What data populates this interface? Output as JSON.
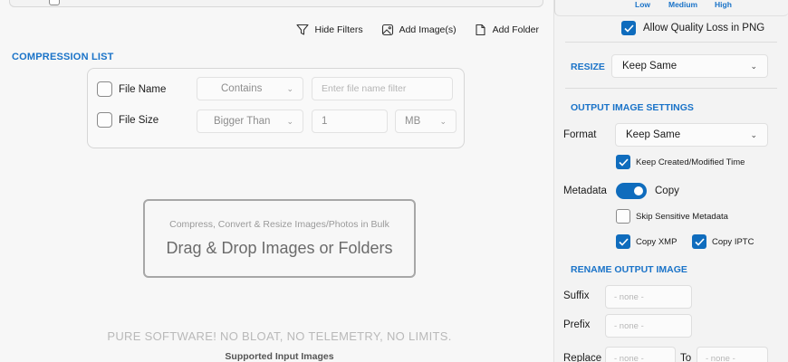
{
  "toolbar": {
    "hide_filters": "Hide Filters",
    "add_images": "Add Image(s)",
    "add_folder": "Add Folder"
  },
  "compression_list": {
    "title": "COMPRESSION LIST",
    "filters": {
      "file_name": {
        "label": "File Name",
        "operator": "Contains",
        "placeholder": "Enter file name filter"
      },
      "file_size": {
        "label": "File Size",
        "operator": "Bigger Than",
        "value": "1",
        "unit": "MB"
      }
    }
  },
  "drop_zone": {
    "subtitle": "Compress, Convert & Resize Images/Photos in Bulk",
    "title": "Drag & Drop Images or Folders"
  },
  "footer": {
    "tagline": "PURE SOFTWARE! NO BLOAT, NO TELEMETRY, NO LIMITS.",
    "supported": "Supported Input Images"
  },
  "settings": {
    "quality_levels": [
      "Low",
      "Medium",
      "High"
    ],
    "allow_quality_loss_png": {
      "label": "Allow Quality Loss in PNG",
      "checked": true
    },
    "resize": {
      "title": "RESIZE",
      "value": "Keep Same"
    },
    "output_settings": {
      "title": "OUTPUT IMAGE SETTINGS",
      "format_label": "Format",
      "format_value": "Keep Same",
      "keep_time": {
        "label": "Keep Created/Modified Time",
        "checked": true
      },
      "metadata_label": "Metadata",
      "metadata_toggle": {
        "label": "Copy",
        "on": true
      },
      "skip_sensitive": {
        "label": "Skip Sensitive Metadata",
        "checked": false
      },
      "copy_xmp": {
        "label": "Copy XMP",
        "checked": true
      },
      "copy_iptc": {
        "label": "Copy IPTC",
        "checked": true
      }
    },
    "rename": {
      "title": "RENAME OUTPUT IMAGE",
      "suffix_label": "Suffix",
      "suffix_value": "- none -",
      "prefix_label": "Prefix",
      "prefix_value": "- none -",
      "replace_label": "Replace",
      "replace_value": "- none -",
      "to_label": "To",
      "to_value": "- none -"
    }
  },
  "colors": {
    "accent": "#0f6cbd",
    "section_title": "#1a73c8"
  }
}
